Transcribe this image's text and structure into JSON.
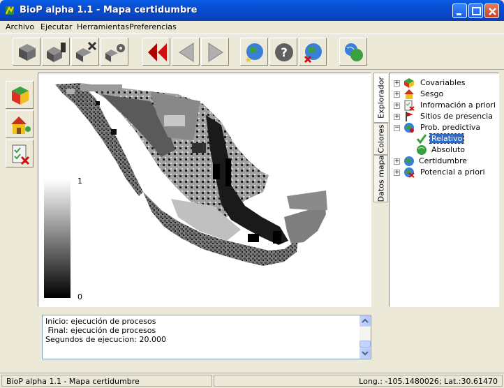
{
  "window": {
    "title": "BioP alpha 1.1 - Mapa certidumbre"
  },
  "menu": [
    "Archivo",
    "Ejecutar",
    "Herramientas",
    "Preferencias"
  ],
  "toolbar": {
    "buttons": [
      {
        "name": "open-layers-icon"
      },
      {
        "name": "run-process-icon"
      },
      {
        "name": "tools-clear-icon"
      },
      {
        "name": "settings-icon"
      },
      {
        "name": "rewind-icon"
      },
      {
        "name": "back-arrow-icon"
      },
      {
        "name": "forward-arrow-icon"
      },
      {
        "name": "globe-star-icon"
      },
      {
        "name": "globe-help-icon"
      },
      {
        "name": "globe-cancel-icon"
      },
      {
        "name": "globe-users-icon"
      }
    ]
  },
  "legend": {
    "max_label": "1",
    "min_label": "0"
  },
  "tabs": [
    "Explorador",
    "Colores",
    "Datos mapa"
  ],
  "tree": [
    {
      "label": "Covariables",
      "expander": "+",
      "icon": "cubes-icon",
      "level": 0
    },
    {
      "label": "Sesgo",
      "expander": "+",
      "icon": "house-icon",
      "level": 0
    },
    {
      "label": "Información a priori",
      "expander": "+",
      "icon": "checklist-icon",
      "level": 0
    },
    {
      "label": "Sitios de presencia",
      "expander": "+",
      "icon": "flag-icon",
      "level": 0
    },
    {
      "label": "Prob. predictiva",
      "expander": "-",
      "icon": "globe-icon",
      "level": 0
    },
    {
      "label": "Relativo",
      "expander": "",
      "icon": "checkmark-icon",
      "level": 1,
      "selected": true
    },
    {
      "label": "Absoluto",
      "expander": "",
      "icon": "green-globe-icon",
      "level": 1
    },
    {
      "label": "Certidumbre",
      "expander": "+",
      "icon": "blue-globe-icon",
      "level": 0
    },
    {
      "label": "Potencial a priori",
      "expander": "+",
      "icon": "globe-x-icon",
      "level": 0
    }
  ],
  "log": {
    "lines": [
      "Inicio: ejecución de procesos",
      " Final: ejecución de procesos",
      "Segundos de ejecucion: 20.000"
    ]
  },
  "status": {
    "left": "BioP alpha 1.1 - Mapa certidumbre",
    "right": "Long.: -105.1480026; Lat.:30.61470"
  },
  "colors": {
    "titlebar": "#0a4fd4",
    "selected": "#316ac5",
    "rewind": "#c00000"
  }
}
